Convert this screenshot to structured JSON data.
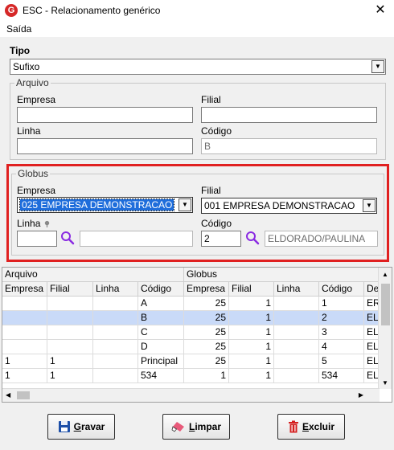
{
  "window": {
    "title": "ESC - Relacionamento genérico",
    "close_glyph": "✕",
    "app_icon_letter": "G"
  },
  "menu": {
    "items": [
      "Saída"
    ]
  },
  "tipo": {
    "label": "Tipo",
    "value": "Sufixo"
  },
  "arquivo": {
    "title": "Arquivo",
    "empresa_label": "Empresa",
    "empresa_value": "",
    "filial_label": "Filial",
    "filial_value": "",
    "linha_label": "Linha",
    "linha_value": "",
    "codigo_label": "Código",
    "codigo_value": "B"
  },
  "globus": {
    "title": "Globus",
    "empresa_label": "Empresa",
    "empresa_value": "025 EMPRESA DEMONSTRACAO",
    "filial_label": "Filial",
    "filial_value": "001 EMPRESA DEMONSTRACAO",
    "linha_label": "Linha",
    "linha_value": "",
    "linha_desc": "",
    "codigo_label": "Código",
    "codigo_value": "2",
    "codigo_desc": "ELDORADO/PAULINA"
  },
  "grid": {
    "group_headers": [
      "Arquivo",
      "Globus"
    ],
    "columns": [
      "Empresa",
      "Filial",
      "Linha",
      "Código",
      "Empresa",
      "Filial",
      "Linha",
      "Código",
      "Des"
    ],
    "rows": [
      [
        "",
        "",
        "",
        "A",
        "25",
        "1",
        "",
        "1",
        "ERI"
      ],
      [
        "",
        "",
        "",
        "B",
        "25",
        "1",
        "",
        "2",
        "ELD"
      ],
      [
        "",
        "",
        "",
        "C",
        "25",
        "1",
        "",
        "3",
        "ELD"
      ],
      [
        "",
        "",
        "",
        "D",
        "25",
        "1",
        "",
        "4",
        "ELD"
      ],
      [
        "1",
        "1",
        "",
        "Principal",
        "25",
        "1",
        "",
        "5",
        "ELD"
      ],
      [
        "1",
        "1",
        "",
        "534",
        "1",
        "1",
        "",
        "534",
        "ELD"
      ]
    ],
    "selected_row": 1
  },
  "buttons": {
    "gravar": {
      "first": "G",
      "rest": "ravar"
    },
    "limpar": {
      "first": "L",
      "rest": "impar"
    },
    "excluir": {
      "first": "E",
      "rest": "xcluir"
    }
  },
  "icons": {
    "search": "magnifier-icon",
    "gravar": "floppy-disk-icon",
    "limpar": "eraser-icon",
    "excluir": "trash-icon"
  },
  "colors": {
    "highlight_border": "#e02020",
    "selection": "#1e6ddb",
    "search_icon": "#8a2be2"
  }
}
